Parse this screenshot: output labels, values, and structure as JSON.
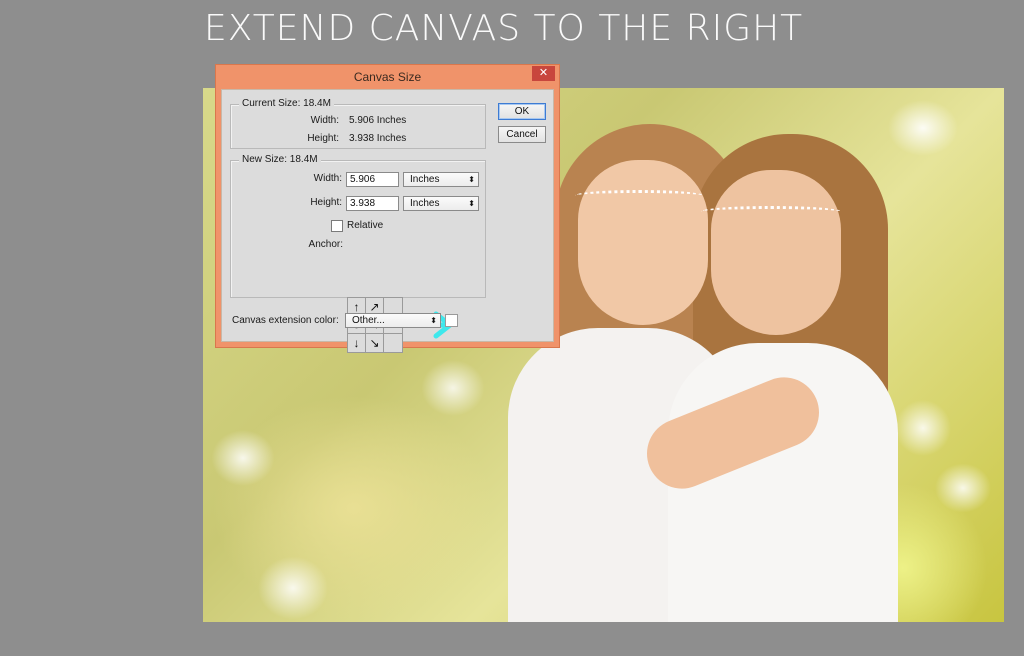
{
  "headline": "EXTEND CANVAS TO THE RIGHT",
  "dialog": {
    "title": "Canvas Size",
    "close_icon": "close-icon",
    "current_size": {
      "label": "Current Size: 18.4M",
      "width_label": "Width:",
      "width_value": "5.906 Inches",
      "height_label": "Height:",
      "height_value": "3.938 Inches"
    },
    "new_size": {
      "label": "New Size: 18.4M",
      "width_label": "Width:",
      "width_value": "5.906",
      "width_unit": "Inches",
      "height_label": "Height:",
      "height_value": "3.938",
      "height_unit": "Inches",
      "relative_label": "Relative",
      "relative_checked": false,
      "anchor_label": "Anchor:",
      "anchor_cells": [
        "↑",
        "↗",
        "",
        "●",
        "→",
        "",
        "↓",
        "↘",
        ""
      ],
      "anchor_selected": "middle-left"
    },
    "extension_color_label": "Canvas extension color:",
    "extension_color_value": "Other...",
    "extension_swatch_color": "#ffffff",
    "ok_label": "OK",
    "cancel_label": "Cancel"
  },
  "annotation": {
    "arrow_color": "#3ee8ec",
    "arrow_direction": "right"
  },
  "colors": {
    "background": "#8e8e8e",
    "dialog_frame": "#f0936a",
    "dialog_body": "#dcdcdc",
    "close_button": "#c8463d"
  }
}
